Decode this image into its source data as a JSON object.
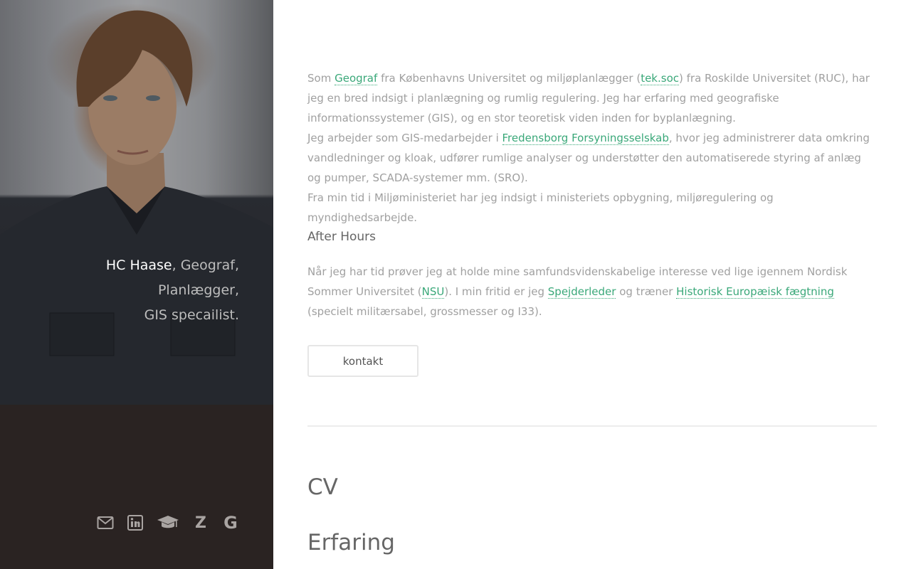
{
  "sidebar": {
    "name": "HC Haase",
    "tagline_line1": ", Geograf, Planlægger,",
    "tagline_line2": "GIS specailist.",
    "social": [
      {
        "icon": "envelope-icon"
      },
      {
        "icon": "linkedin-icon"
      },
      {
        "icon": "graduation-cap-icon"
      },
      {
        "icon": "zotero-icon",
        "glyph": "Z"
      },
      {
        "icon": "google-icon",
        "glyph": "G"
      }
    ]
  },
  "intro": {
    "p1_before": "Som ",
    "p1_link1": "Geograf",
    "p1_mid": " fra Københavns Universitet og miljøplanlægger (",
    "p1_link2": "tek.soc",
    "p1_after": ") fra Roskilde Universitet (RUC), har jeg en bred indsigt i planlægning og rumlig regulering. Jeg har erfaring med geografiske informationssystemer (GIS), og en stor teoretisk viden inden for byplanlægning.",
    "p2_before": "Jeg arbejder som GIS-medarbejder i ",
    "p2_link": "Fredensborg Forsyningsselskab",
    "p2_after": ", hvor jeg administrerer data omkring vandledninger og kloak, udfører rumlige analyser og understøtter den automatiserede styring af anlæg og pumper, SCADA-systemer mm. (SRO).",
    "p3": "Fra min tid i Miljøministeriet har jeg indsigt i ministeriets opbygning, miljøregulering og myndighedsarbejde."
  },
  "after_hours": {
    "heading": "After Hours",
    "t1": "Når jeg har tid prøver jeg at holde mine samfundsvidenskabelige interesse ved lige igennem Nordisk Sommer Universitet (",
    "link1": "NSU",
    "t2": "). I min fritid er jeg ",
    "link2": "Spejderleder",
    "t3": " og træner ",
    "link3": "Historisk Europæisk fægtning",
    "t4": " (specielt militærsabel, grossmesser og I33)."
  },
  "contact_label": "kontakt",
  "cv_heading": "CV",
  "experience_heading": "Erfaring",
  "colors": {
    "accent": "#3aa879",
    "sidebar_bg": "#2a2322",
    "body_text": "#a0a0a0"
  }
}
